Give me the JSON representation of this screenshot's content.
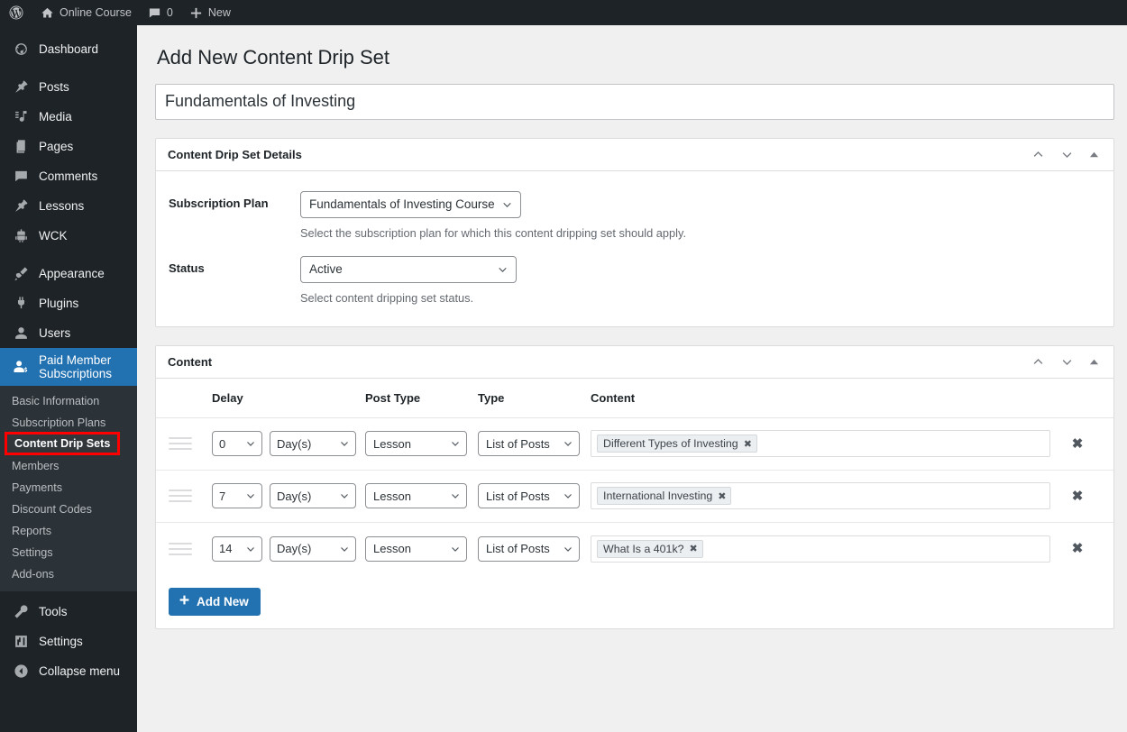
{
  "adminbar": {
    "logo_icon": "wordpress-logo-icon",
    "site_name": "Online Course",
    "home_icon": "home-icon",
    "comments_icon": "comment-bubble-icon",
    "comments_count": "0",
    "new_icon": "plus-icon",
    "new_label": "New"
  },
  "sidebar": {
    "items": [
      {
        "label": "Dashboard",
        "icon": "dashboard-icon",
        "gap_after": true
      },
      {
        "label": "Posts",
        "icon": "pin-icon",
        "gap_after": false
      },
      {
        "label": "Media",
        "icon": "media-icon",
        "gap_after": false
      },
      {
        "label": "Pages",
        "icon": "pages-icon",
        "gap_after": false
      },
      {
        "label": "Comments",
        "icon": "comment-bubble-icon",
        "gap_after": false
      },
      {
        "label": "Lessons",
        "icon": "pin-icon",
        "gap_after": false
      },
      {
        "label": "WCK",
        "icon": "wck-robot-icon",
        "gap_after": true
      },
      {
        "label": "Appearance",
        "icon": "paintbrush-icon",
        "gap_after": false
      },
      {
        "label": "Plugins",
        "icon": "plug-icon",
        "gap_after": false
      },
      {
        "label": "Users",
        "icon": "user-icon",
        "gap_after": false
      }
    ],
    "active_item": {
      "label": "Paid Member Subscriptions",
      "icon": "paid-member-icon"
    },
    "submenu": [
      {
        "label": "Basic Information",
        "highlighted": false
      },
      {
        "label": "Subscription Plans",
        "highlighted": false
      },
      {
        "label": "Content Drip Sets",
        "highlighted": true
      },
      {
        "label": "Members",
        "highlighted": false
      },
      {
        "label": "Payments",
        "highlighted": false
      },
      {
        "label": "Discount Codes",
        "highlighted": false
      },
      {
        "label": "Reports",
        "highlighted": false
      },
      {
        "label": "Settings",
        "highlighted": false
      },
      {
        "label": "Add-ons",
        "highlighted": false
      }
    ],
    "bottom_items": [
      {
        "label": "Tools",
        "icon": "wrench-icon"
      },
      {
        "label": "Settings",
        "icon": "settings-sliders-icon"
      },
      {
        "label": "Collapse menu",
        "icon": "collapse-arrow-icon"
      }
    ],
    "highlight_color": "#ff0000",
    "active_color": "#2271b1"
  },
  "page": {
    "title": "Add New Content Drip Set",
    "title_input_value": "Fundamentals of Investing",
    "title_input_placeholder": "Enter title here"
  },
  "details_panel": {
    "heading": "Content Drip Set Details",
    "collapse_up_icon": "chevron-up-icon",
    "collapse_down_icon": "chevron-down-icon",
    "toggle_icon": "triangle-up-icon",
    "fields": [
      {
        "label": "Subscription Plan",
        "value": "Fundamentals of Investing Course",
        "description": "Select the subscription plan for which this content dripping set should apply."
      },
      {
        "label": "Status",
        "value": "Active",
        "description": "Select content dripping set status."
      }
    ]
  },
  "content_panel": {
    "heading": "Content",
    "collapse_up_icon": "chevron-up-icon",
    "collapse_down_icon": "chevron-down-icon",
    "toggle_icon": "triangle-up-icon",
    "columns": [
      "Delay",
      "Post Type",
      "Type",
      "Content"
    ],
    "rows": [
      {
        "handle_icon": "drag-handle-icon",
        "delay": "0",
        "unit": "Day(s)",
        "post_type": "Lesson",
        "type": "List of Posts",
        "tag": "Different Types of Investing",
        "tag_remove_icon": "close-x-icon",
        "remove_icon": "close-x-icon"
      },
      {
        "handle_icon": "drag-handle-icon",
        "delay": "7",
        "unit": "Day(s)",
        "post_type": "Lesson",
        "type": "List of Posts",
        "tag": "International Investing",
        "tag_remove_icon": "close-x-icon",
        "remove_icon": "close-x-icon"
      },
      {
        "handle_icon": "drag-handle-icon",
        "delay": "14",
        "unit": "Day(s)",
        "post_type": "Lesson",
        "type": "List of Posts",
        "tag": "What Is a 401k?",
        "tag_remove_icon": "close-x-icon",
        "remove_icon": "close-x-icon"
      }
    ],
    "add_new_label": "Add New",
    "add_new_icon": "plus-icon"
  }
}
